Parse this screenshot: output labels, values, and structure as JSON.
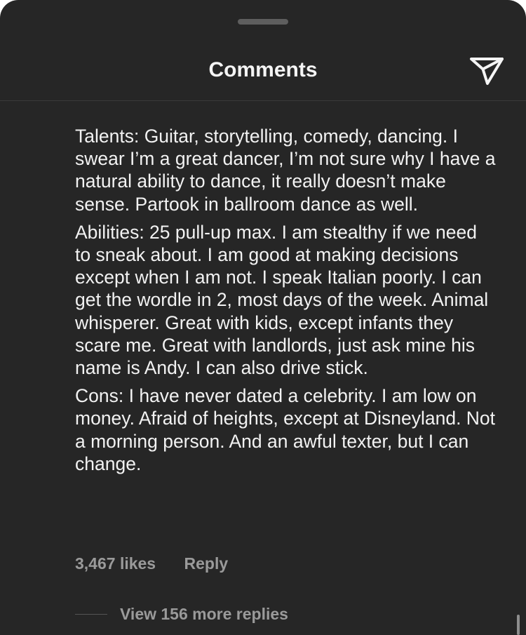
{
  "header": {
    "title": "Comments"
  },
  "icons": {
    "share": "paper-plane-icon",
    "handle": "drag-handle"
  },
  "comment": {
    "paragraphs": [
      "Talents: Guitar, storytelling, comedy, dancing. I swear I’m a great dancer, I’m not sure why I have a natural ability to dance, it really doesn’t make sense. Partook in ballroom dance as well.",
      "Abilities: 25 pull-up max. I am stealthy if we need to sneak about. I am good at making decisions except when I am not. I speak Italian poorly. I can get the wordle in 2, most days of the week. Animal whisperer. Great with kids, except infants they scare me. Great with landlords, just ask mine his name is Andy. I can also drive stick.",
      "Cons: I have never dated a celebrity. I am low on money. Afraid of heights, except at Disneyland. Not a morning person. And an awful texter, but I can change."
    ],
    "likes": "3,467 likes",
    "reply_label": "Reply",
    "view_replies_label": "View 156 more replies"
  },
  "colors": {
    "background": "#262626",
    "text_primary": "#f2f2f2",
    "text_secondary": "#9a9a9a",
    "divider": "#3a3a3a"
  }
}
